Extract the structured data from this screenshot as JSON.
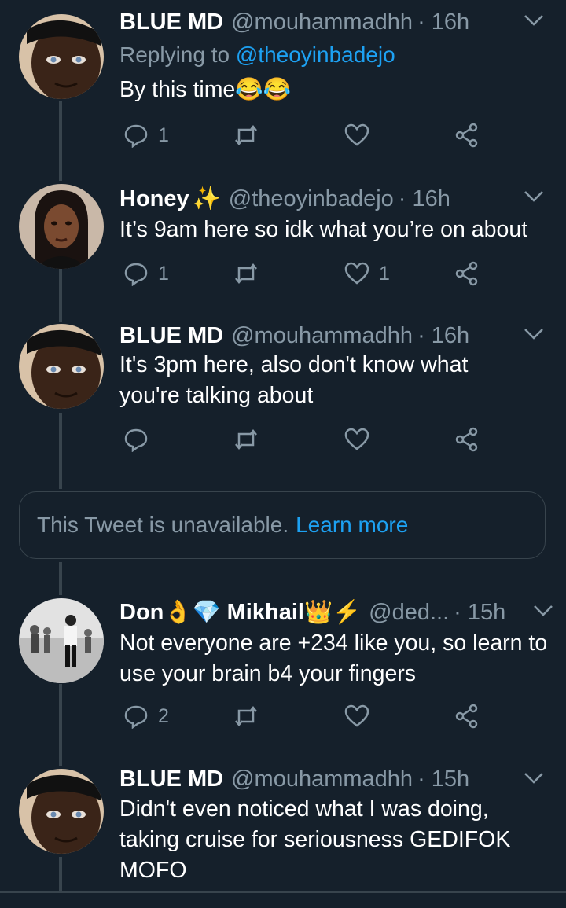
{
  "tweets": [
    {
      "name": "BLUE MD",
      "handle": "@mouhammadhh",
      "time": "· 16h",
      "replying_prefix": "Replying to",
      "replying_handle": "@theoyinbadejo",
      "text": "By this time😂😂",
      "reply_count": "1",
      "retweet_count": "",
      "like_count": ""
    },
    {
      "name": "Honey",
      "name_emoji": "✨",
      "handle": "@theoyinbadejo",
      "time": "· 16h",
      "text": "It’s 9am here so idk what you’re on about",
      "reply_count": "1",
      "retweet_count": "",
      "like_count": "1"
    },
    {
      "name": "BLUE MD",
      "handle": "@mouhammadhh",
      "time": "· 16h",
      "text": "It's 3pm here, also don't know what you're talking about",
      "reply_count": "",
      "retweet_count": "",
      "like_count": ""
    },
    {
      "name": "Don👌💎 Mikhail👑⚡",
      "handle": "@ded...",
      "time": "· 15h",
      "text": "Not everyone are +234 like you, so learn to use your brain b4 your fingers",
      "reply_count": "2",
      "retweet_count": "",
      "like_count": ""
    },
    {
      "name": "BLUE MD",
      "handle": "@mouhammadhh",
      "time": "· 15h",
      "text": "Didn't even noticed what I was doing, taking cruise for seriousness GEDIFOK MOFO",
      "reply_count": "",
      "retweet_count": "",
      "like_count": ""
    }
  ],
  "unavailable": {
    "text": "This Tweet is unavailable.",
    "link": "Learn more"
  },
  "colors": {
    "background": "#15202b",
    "secondary_text": "#8899a6",
    "accent": "#1da1f2",
    "divider": "#38444d"
  }
}
